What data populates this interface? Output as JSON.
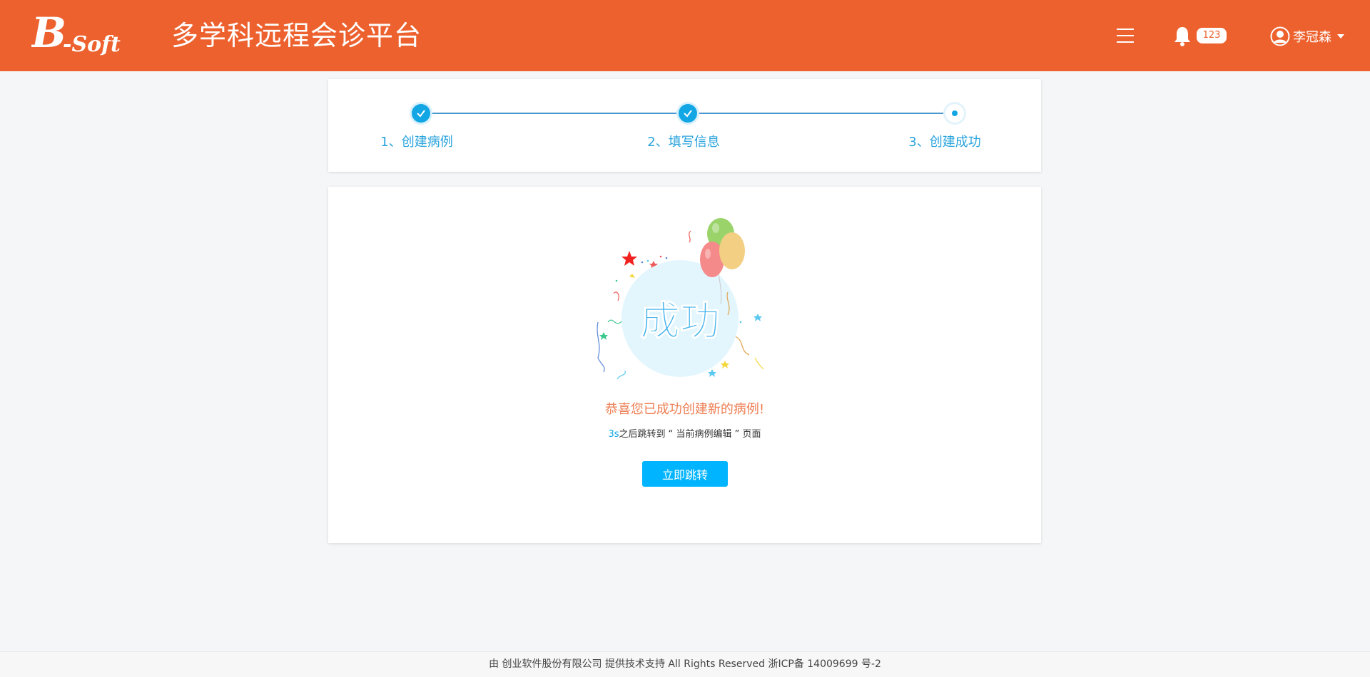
{
  "header": {
    "logo_text": "B-Soft",
    "title": "多学科远程会诊平台",
    "notification_count": "123",
    "user_name": "李冠森",
    "bg_color": "#ed612e"
  },
  "steps": [
    {
      "label": "1、创建病例",
      "state": "done"
    },
    {
      "label": "2、填写信息",
      "state": "done"
    },
    {
      "label": "3、创建成功",
      "state": "current"
    }
  ],
  "result": {
    "badge_text": "成功",
    "message": "恭喜您已成功创建新的病例!",
    "countdown": "3s",
    "redirect_text": "之后跳转到 “ 当前病例编辑 ” 页面",
    "button_label": "立即跳转"
  },
  "footer": {
    "text": "由 创业软件股份有限公司 提供技术支持 All Rights Reserved 浙ICP备 14009699 号-2"
  },
  "colors": {
    "accent": "#12a6e5",
    "button": "#00b4ff",
    "message": "#ed7e52"
  }
}
